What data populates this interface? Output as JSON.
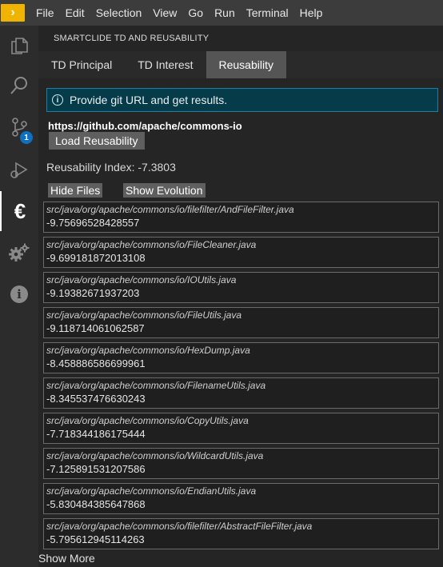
{
  "menu": {
    "logo_glyph": "›",
    "items": [
      "File",
      "Edit",
      "Selection",
      "View",
      "Go",
      "Run",
      "Terminal",
      "Help"
    ]
  },
  "activity_bar": {
    "icons": [
      "explorer-icon",
      "search-icon",
      "source-control-icon",
      "run-debug-icon",
      "euro-icon",
      "gears-icon",
      "info-icon"
    ],
    "scm_badge": "1",
    "euro_glyph": "€",
    "info_glyph": "i"
  },
  "panel": {
    "title": "SMARTCLIDE TD AND REUSABILITY",
    "tabs": [
      "TD Principal",
      "TD Interest",
      "Reusability"
    ],
    "active_tab": "Reusability",
    "info_message": "Provide git URL and get results.",
    "git_url": "https://github.com/apache/commons-io",
    "load_button": "Load Reusability",
    "reusability_index": "Reusability Index: -7.3803",
    "hide_files_button": "Hide Files",
    "show_evolution_button": "Show Evolution",
    "files": [
      {
        "path": "src/java/org/apache/commons/io/filefilter/AndFileFilter.java",
        "score": "-9.75696528428557"
      },
      {
        "path": "src/java/org/apache/commons/io/FileCleaner.java",
        "score": "-9.699181872013108"
      },
      {
        "path": "src/java/org/apache/commons/io/IOUtils.java",
        "score": "-9.19382671937203"
      },
      {
        "path": "src/java/org/apache/commons/io/FileUtils.java",
        "score": "-9.118714061062587"
      },
      {
        "path": "src/java/org/apache/commons/io/HexDump.java",
        "score": "-8.458886586699961"
      },
      {
        "path": "src/java/org/apache/commons/io/FilenameUtils.java",
        "score": "-8.345537476630243"
      },
      {
        "path": "src/java/org/apache/commons/io/CopyUtils.java",
        "score": "-7.718344186175444"
      },
      {
        "path": "src/java/org/apache/commons/io/WildcardUtils.java",
        "score": "-7.125891531207586"
      },
      {
        "path": "src/java/org/apache/commons/io/EndianUtils.java",
        "score": "-5.830484385647868"
      },
      {
        "path": "src/java/org/apache/commons/io/filefilter/AbstractFileFilter.java",
        "score": "-5.795612945114263"
      }
    ],
    "show_more": "Show More"
  },
  "colors": {
    "menubar": "#3c3c3c",
    "activity_bar": "#2c2c2c",
    "panel": "#252526",
    "info_bg": "#063b49",
    "info_border": "#1b7fa3",
    "badge": "#0e70c0",
    "button": "#5f5f5f"
  }
}
